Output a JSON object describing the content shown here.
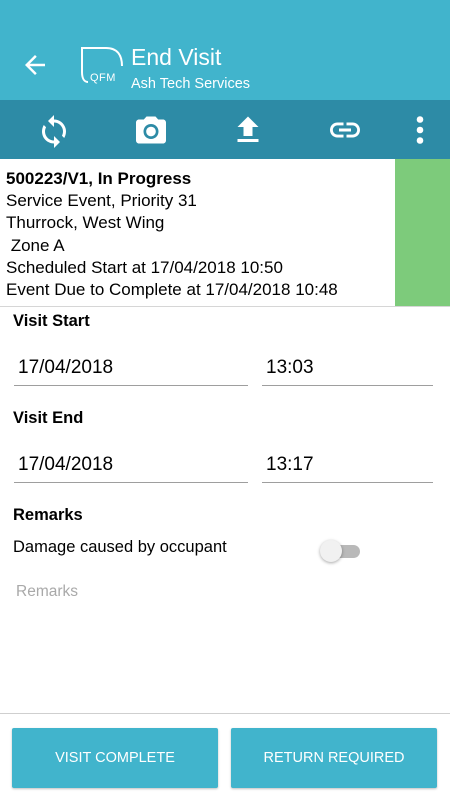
{
  "header": {
    "title": "End Visit",
    "subtitle": "Ash Tech Services",
    "logo_text": "QFM",
    "back_icon": "arrow-left-icon"
  },
  "toolbar": {
    "icons": [
      "refresh-icon",
      "camera-icon",
      "upload-icon",
      "link-icon",
      "more-vertical-icon"
    ]
  },
  "event": {
    "line1": "500223/V1, In Progress",
    "line2": "Service Event, Priority 31",
    "line3": "Thurrock, West Wing",
    "line4": " Zone A",
    "line5": "Scheduled Start at 17/04/2018 10:50",
    "line6": "Event Due to Complete at 17/04/2018 10:48",
    "status_color": "#7dcb7b"
  },
  "form": {
    "visit_start_label": "Visit Start",
    "visit_start_date": "17/04/2018",
    "visit_start_time": "13:03",
    "visit_end_label": "Visit End",
    "visit_end_date": "17/04/2018",
    "visit_end_time": "13:17",
    "remarks_label": "Remarks",
    "damage_label": "Damage caused by occupant",
    "damage_on": false,
    "remarks_placeholder": "Remarks"
  },
  "actions": {
    "complete_label": "VISIT COMPLETE",
    "return_label": "RETURN REQUIRED"
  },
  "colors": {
    "appbar": "#41b4cc",
    "toolbar": "#2d8ba6"
  }
}
